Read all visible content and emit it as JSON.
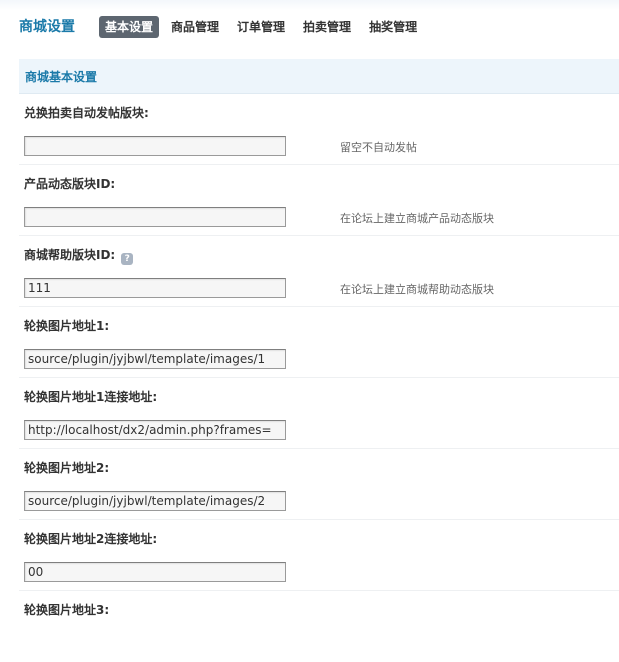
{
  "header": {
    "title": "商城设置",
    "tabs": [
      {
        "label": "基本设置",
        "active": true
      },
      {
        "label": "商品管理",
        "active": false
      },
      {
        "label": "订单管理",
        "active": false
      },
      {
        "label": "拍卖管理",
        "active": false
      },
      {
        "label": "抽奖管理",
        "active": false
      }
    ]
  },
  "section": {
    "title": "商城基本设置"
  },
  "settings": [
    {
      "label": "兑换拍卖自动发帖版块:",
      "value": "",
      "hint": "留空不自动发帖"
    },
    {
      "label": "产品动态版块ID:",
      "value": "",
      "hint": "在论坛上建立商城产品动态版块"
    },
    {
      "label": "商城帮助版块ID:",
      "value": "111",
      "hint": "在论坛上建立商城帮助动态版块"
    },
    {
      "label": "轮换图片地址1:",
      "value": "source/plugin/jyjbwl/template/images/1",
      "hint": ""
    },
    {
      "label": "轮换图片地址1连接地址:",
      "value": "http://localhost/dx2/admin.php?frames=",
      "hint": ""
    },
    {
      "label": "轮换图片地址2:",
      "value": "source/plugin/jyjbwl/template/images/2",
      "hint": ""
    },
    {
      "label": "轮换图片地址2连接地址:",
      "value": "00",
      "hint": ""
    },
    {
      "label": "轮换图片地址3:",
      "value": "",
      "hint": ""
    }
  ],
  "colors": {
    "accent": "#1b7aa9",
    "active_tab_bg": "#5d6670",
    "section_bg": "#edf5fb"
  },
  "icons": {
    "help": "question-icon"
  }
}
